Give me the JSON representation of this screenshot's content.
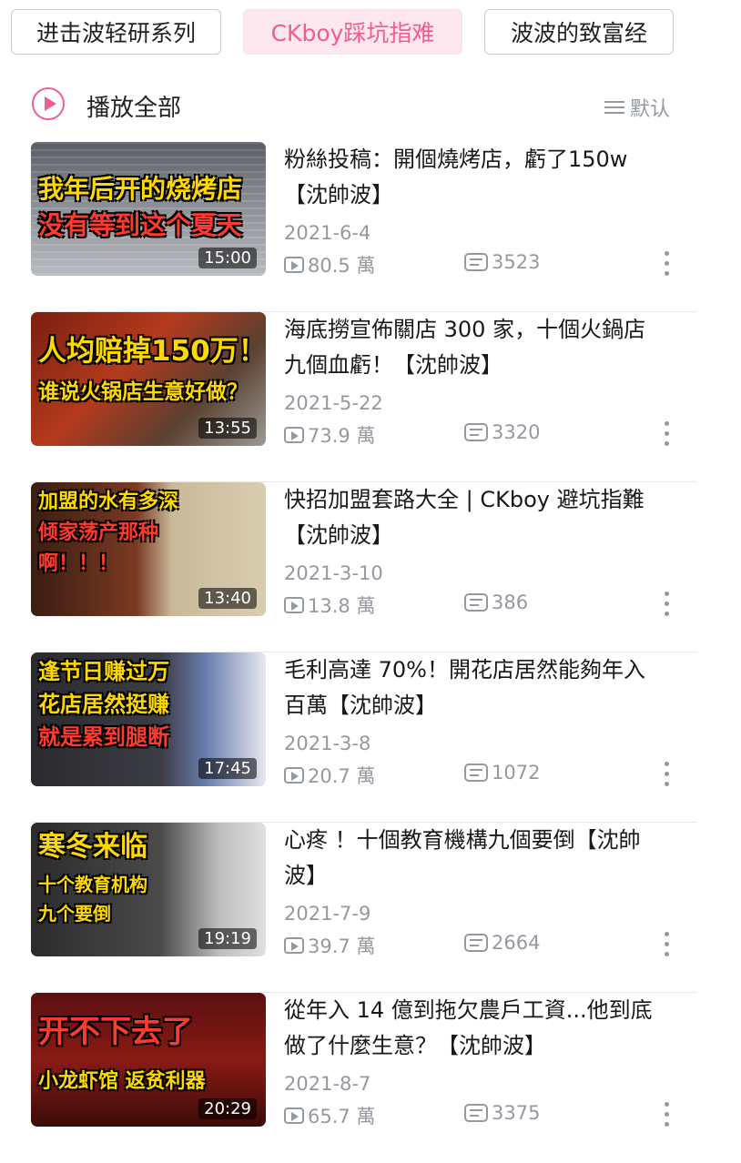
{
  "tabs": [
    "进击波轻研系列",
    "CKboy踩坑指难",
    "波波的致富经"
  ],
  "play_all_label": "播放全部",
  "sort_label": "默认",
  "videos": [
    {
      "title": "粉絲投稿：開個燒烤店，虧了150w【沈帥波】",
      "date": "2021-6-4",
      "views": "80.5 萬",
      "comments": "3523",
      "duration": "15:00",
      "thumb_lines": [
        "我年后开的烧烤店",
        "没有等到这个夏天"
      ]
    },
    {
      "title": "海底撈宣佈關店 300 家，十個火鍋店九個血虧！【沈帥波】",
      "date": "2021-5-22",
      "views": "73.9 萬",
      "comments": "3320",
      "duration": "13:55",
      "thumb_lines": [
        "人均赔掉150万！",
        "谁说火锅店生意好做？"
      ]
    },
    {
      "title": "快招加盟套路大全 | CKboy 避坑指難【沈帥波】",
      "date": "2021-3-10",
      "views": "13.8 萬",
      "comments": "386",
      "duration": "13:40",
      "thumb_lines": [
        "加盟的水有多深",
        "倾家荡产那种",
        "啊！！！"
      ]
    },
    {
      "title": "毛利高達 70%！開花店居然能夠年入百萬【沈帥波】",
      "date": "2021-3-8",
      "views": "20.7 萬",
      "comments": "1072",
      "duration": "17:45",
      "thumb_lines": [
        "逢节日赚过万",
        "花店居然挺赚",
        "就是累到腿断"
      ]
    },
    {
      "title": "心疼 ！十個教育機構九個要倒【沈帥波】",
      "date": "2021-7-9",
      "views": "39.7 萬",
      "comments": "2664",
      "duration": "19:19",
      "thumb_lines": [
        "寒冬来临",
        "十个教育机构",
        "九个要倒"
      ]
    },
    {
      "title": "從年入 14 億到拖欠農戶工資...他到底做了什麼生意？【沈帥波】",
      "date": "2021-8-7",
      "views": "65.7 萬",
      "comments": "3375",
      "duration": "20:29",
      "thumb_lines": [
        "开不下去了",
        "小龙虾馆  返贫利器"
      ]
    }
  ]
}
